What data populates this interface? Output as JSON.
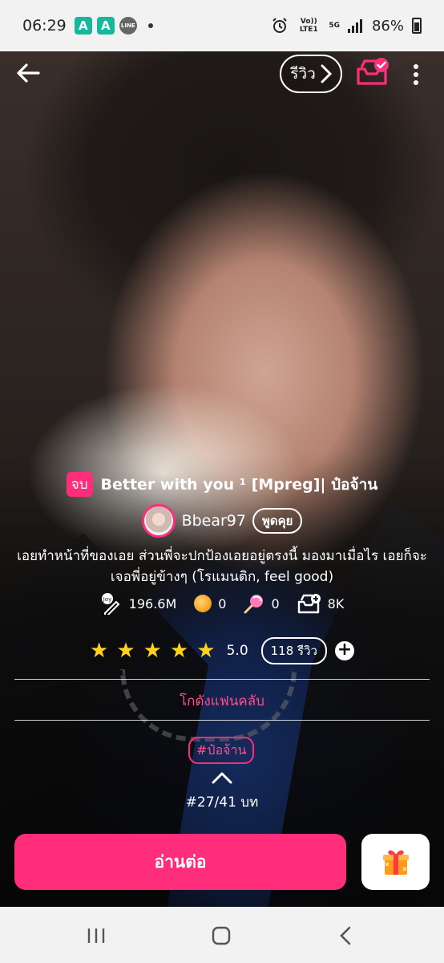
{
  "status_bar": {
    "time": "06:29",
    "notif_a1": "A",
    "notif_a2": "A",
    "line": "LINE",
    "volte": "Vo)) LTE1",
    "network": "5G",
    "battery": "86%"
  },
  "top_bar": {
    "review_label": "รีวิว"
  },
  "story": {
    "status_badge": "จบ",
    "title": "Better with you ¹ [Mpreg]| ป๋อจ้าน",
    "author": "Bbear97",
    "talk_label": "พูดคุย",
    "synopsis": "เอยทำหน้าที่ของเอย ส่วนพี่จะปกป้องเอยอยู่ตรงนี้ มองมาเมื่อไร เอยก็จะเจอพี่อยู่ข้างๆ (โรแมนติก, feel good)"
  },
  "stats": {
    "views": "196.6M",
    "coins": "0",
    "lollipops": "0",
    "library_adds": "8K"
  },
  "rating": {
    "stars": 5,
    "value": "5.0",
    "review_count": "118 รีวิว"
  },
  "fanclub_label": "โกดังแฟนคลับ",
  "tag": "#ป๋อจ้าน",
  "chapter_info": "#27/41 บท",
  "continue_label": "อ่านต่อ",
  "colors": {
    "accent": "#ff2d7a",
    "star": "#ffd21f"
  }
}
